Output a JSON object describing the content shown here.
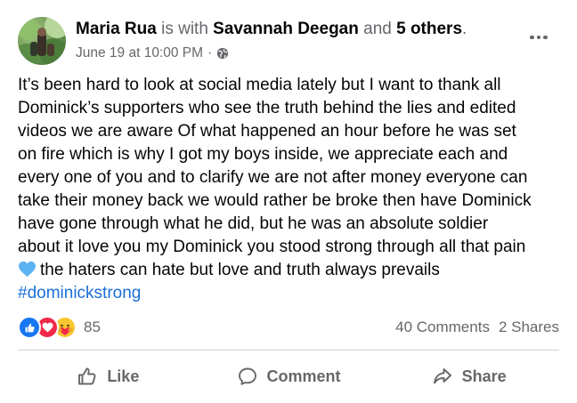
{
  "post": {
    "author": "Maria Rua",
    "with_word": "is with",
    "tagged": "Savannah Deegan",
    "and_word": "and",
    "others": "5 others",
    "trailing": ".",
    "date": "June 19 at 10:00 PM",
    "date_sep": "·",
    "privacy_icon": "globe-icon",
    "more_icon": "more-options-icon"
  },
  "body": {
    "lines": [
      "It’s been hard to look at social media lately but I want to thank all",
      "Dominick’s supporters who see the truth behind the lies and edited",
      "videos we are aware Of what happened an hour before he was set",
      "on fire which is why I got my boys inside, we appreciate each and",
      "every one of you and to clarify we are not after money everyone can",
      "take their money back we would rather be broke then have Dominick",
      "have gone through what he did, but he was an absolute soldier",
      "about it love you my Dominick you stood strong through all that pain"
    ],
    "last_line": "the haters can hate but love and truth always prevails",
    "emoji": "blue-heart-emoji",
    "hashtag": "#dominickstrong"
  },
  "stats": {
    "reaction_icons": [
      "like-reaction-icon",
      "love-reaction-icon",
      "care-reaction-icon"
    ],
    "reaction_count": "85",
    "comments": "40 Comments",
    "shares": "2 Shares"
  },
  "actions": {
    "like": "Like",
    "comment": "Comment",
    "share": "Share"
  },
  "colors": {
    "text": "#050505",
    "muted": "#65676b",
    "link": "#1a6ed8",
    "like": "#1877f2",
    "love": "#f0284a",
    "care": "#f7c631",
    "divider": "#ced0d4"
  }
}
